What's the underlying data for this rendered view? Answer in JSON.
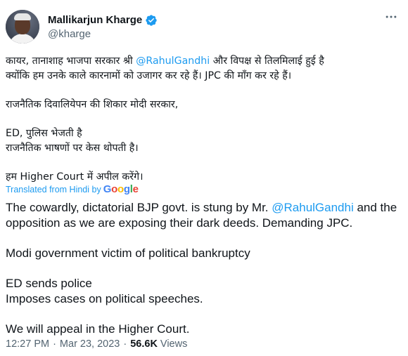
{
  "author": {
    "display_name": "Mallikarjun Kharge",
    "handle": "@kharge",
    "verified": true
  },
  "icons": {
    "verified": "verified-badge-icon",
    "more": "more-options-icon",
    "avatar": "avatar"
  },
  "original": {
    "line1_pre": "कायर, तानाशाह भाजपा सरकार श्री ",
    "line1_mention": "@RahulGandhi",
    "line1_post": " और विपक्ष से तिलमिलाई हुई है",
    "line2": "क्योंकि हम उनके काले कारनामों को उजागर कर रहे हैं। JPC की माँग कर रहे हैं।",
    "line3": "राजनैतिक दिवालियेपन की शिकार मोदी सरकार,",
    "line4": "ED, पुलिस भेजती है",
    "line5": "राजनैतिक भाषणों पर केस थोपती है।",
    "line6": "हम Higher Court में अपील करेंगे।"
  },
  "translation": {
    "label": "Translated from Hindi by",
    "provider": "Google",
    "line1_pre": "The cowardly, dictatorial BJP govt. is stung by Mr. ",
    "line1_mention": "@RahulGandhi",
    "line1_post": " and the",
    "line2": "opposition as we are exposing their dark deeds. Demanding JPC.",
    "line3": "Modi government victim of political bankruptcy",
    "line4": "ED sends police",
    "line5": "Imposes cases on political speeches.",
    "line6": "We will appeal in the Higher Court."
  },
  "meta": {
    "time": "12:27 PM",
    "separator": "·",
    "date": "Mar 23, 2023",
    "views_count": "56.6K",
    "views_label": "Views"
  },
  "colors": {
    "accent": "#1d9bf0",
    "text": "#0f1419",
    "muted": "#536471"
  }
}
